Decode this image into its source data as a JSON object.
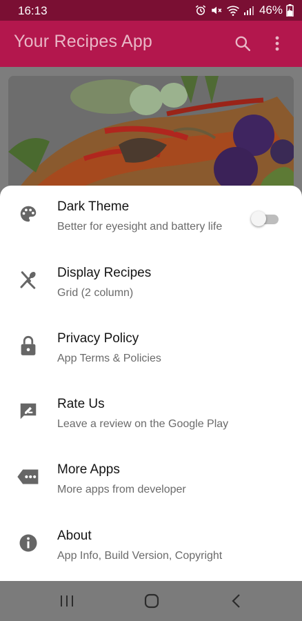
{
  "status_bar": {
    "time": "16:13",
    "battery_percent": "46%",
    "icons": [
      "alarm-icon",
      "mute-icon",
      "wifi-icon",
      "signal-icon",
      "battery-charging-icon"
    ]
  },
  "app_bar": {
    "title": "Your Recipes App",
    "actions": [
      "search-icon",
      "more-vert-icon"
    ],
    "color": "#b3174d"
  },
  "hero_image": {
    "alt_subject": "grilled fish with vegetables"
  },
  "settings": {
    "items": [
      {
        "icon": "palette-icon",
        "title": "Dark Theme",
        "subtitle": "Better for eyesight and battery life",
        "toggle": false
      },
      {
        "icon": "utensils-icon",
        "title": "Display Recipes",
        "subtitle": "Grid (2 column)"
      },
      {
        "icon": "lock-icon",
        "title": "Privacy Policy",
        "subtitle": "App Terms & Policies"
      },
      {
        "icon": "rate-review-icon",
        "title": "Rate Us",
        "subtitle": "Leave a review on the Google Play"
      },
      {
        "icon": "more-tag-icon",
        "title": "More Apps",
        "subtitle": "More apps from developer"
      },
      {
        "icon": "info-icon",
        "title": "About",
        "subtitle": "App Info, Build Version, Copyright"
      }
    ]
  },
  "nav_bar": {
    "buttons": [
      "recent-apps-icon",
      "home-icon",
      "back-icon"
    ]
  }
}
